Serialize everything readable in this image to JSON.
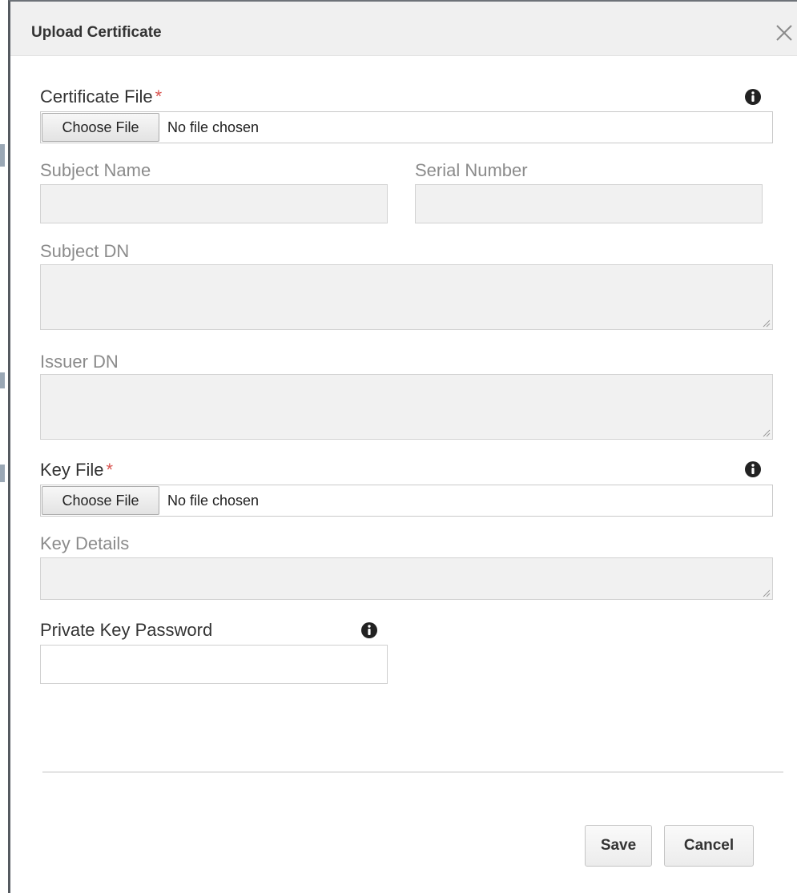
{
  "dialog": {
    "title": "Upload Certificate"
  },
  "certificate_file": {
    "label": "Certificate File",
    "required_marker": "*",
    "button_label": "Choose File",
    "status": "No file chosen"
  },
  "subject_name": {
    "label": "Subject Name",
    "value": ""
  },
  "serial_number": {
    "label": "Serial Number",
    "value": ""
  },
  "subject_dn": {
    "label": "Subject DN",
    "value": ""
  },
  "issuer_dn": {
    "label": "Issuer DN",
    "value": ""
  },
  "key_file": {
    "label": "Key File",
    "required_marker": "*",
    "button_label": "Choose File",
    "status": "No file chosen"
  },
  "key_details": {
    "label": "Key Details",
    "value": ""
  },
  "private_key_password": {
    "label": "Private Key Password",
    "value": ""
  },
  "footer": {
    "save_label": "Save",
    "cancel_label": "Cancel"
  },
  "icons": {
    "close": "close-icon",
    "info": "info-icon"
  },
  "colors": {
    "required": "#d9534f",
    "header_bg": "#f0f0f0",
    "readonly_bg": "#f1f1f1"
  }
}
